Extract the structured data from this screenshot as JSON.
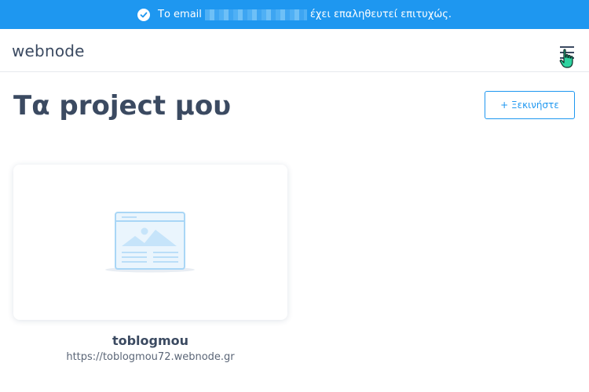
{
  "banner": {
    "prefix": "Το email",
    "suffix": "έχει επαληθευτεί επιτυχώς.",
    "icon": "check-circle-icon",
    "color": "#1e97f0"
  },
  "header": {
    "logo": "webnode",
    "menu_icon": "hamburger-menu-icon"
  },
  "main": {
    "title": "Τα project μου",
    "start_button": "+ Ξεκινήστε",
    "accent": "#1e97f0"
  },
  "projects": [
    {
      "name": "toblogmou",
      "url": "https://toblogmou72.webnode.gr",
      "thumbnail_icon": "website-placeholder-icon"
    }
  ]
}
